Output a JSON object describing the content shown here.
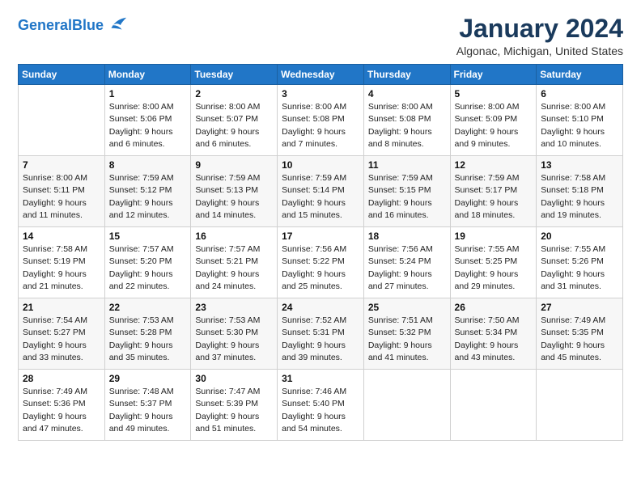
{
  "logo": {
    "line1": "General",
    "line2": "Blue"
  },
  "title": "January 2024",
  "subtitle": "Algonac, Michigan, United States",
  "days_of_week": [
    "Sunday",
    "Monday",
    "Tuesday",
    "Wednesday",
    "Thursday",
    "Friday",
    "Saturday"
  ],
  "weeks": [
    [
      {
        "day": "",
        "info": ""
      },
      {
        "day": "1",
        "info": "Sunrise: 8:00 AM\nSunset: 5:06 PM\nDaylight: 9 hours\nand 6 minutes."
      },
      {
        "day": "2",
        "info": "Sunrise: 8:00 AM\nSunset: 5:07 PM\nDaylight: 9 hours\nand 6 minutes."
      },
      {
        "day": "3",
        "info": "Sunrise: 8:00 AM\nSunset: 5:08 PM\nDaylight: 9 hours\nand 7 minutes."
      },
      {
        "day": "4",
        "info": "Sunrise: 8:00 AM\nSunset: 5:08 PM\nDaylight: 9 hours\nand 8 minutes."
      },
      {
        "day": "5",
        "info": "Sunrise: 8:00 AM\nSunset: 5:09 PM\nDaylight: 9 hours\nand 9 minutes."
      },
      {
        "day": "6",
        "info": "Sunrise: 8:00 AM\nSunset: 5:10 PM\nDaylight: 9 hours\nand 10 minutes."
      }
    ],
    [
      {
        "day": "7",
        "info": "Sunrise: 8:00 AM\nSunset: 5:11 PM\nDaylight: 9 hours\nand 11 minutes."
      },
      {
        "day": "8",
        "info": "Sunrise: 7:59 AM\nSunset: 5:12 PM\nDaylight: 9 hours\nand 12 minutes."
      },
      {
        "day": "9",
        "info": "Sunrise: 7:59 AM\nSunset: 5:13 PM\nDaylight: 9 hours\nand 14 minutes."
      },
      {
        "day": "10",
        "info": "Sunrise: 7:59 AM\nSunset: 5:14 PM\nDaylight: 9 hours\nand 15 minutes."
      },
      {
        "day": "11",
        "info": "Sunrise: 7:59 AM\nSunset: 5:15 PM\nDaylight: 9 hours\nand 16 minutes."
      },
      {
        "day": "12",
        "info": "Sunrise: 7:59 AM\nSunset: 5:17 PM\nDaylight: 9 hours\nand 18 minutes."
      },
      {
        "day": "13",
        "info": "Sunrise: 7:58 AM\nSunset: 5:18 PM\nDaylight: 9 hours\nand 19 minutes."
      }
    ],
    [
      {
        "day": "14",
        "info": "Sunrise: 7:58 AM\nSunset: 5:19 PM\nDaylight: 9 hours\nand 21 minutes."
      },
      {
        "day": "15",
        "info": "Sunrise: 7:57 AM\nSunset: 5:20 PM\nDaylight: 9 hours\nand 22 minutes."
      },
      {
        "day": "16",
        "info": "Sunrise: 7:57 AM\nSunset: 5:21 PM\nDaylight: 9 hours\nand 24 minutes."
      },
      {
        "day": "17",
        "info": "Sunrise: 7:56 AM\nSunset: 5:22 PM\nDaylight: 9 hours\nand 25 minutes."
      },
      {
        "day": "18",
        "info": "Sunrise: 7:56 AM\nSunset: 5:24 PM\nDaylight: 9 hours\nand 27 minutes."
      },
      {
        "day": "19",
        "info": "Sunrise: 7:55 AM\nSunset: 5:25 PM\nDaylight: 9 hours\nand 29 minutes."
      },
      {
        "day": "20",
        "info": "Sunrise: 7:55 AM\nSunset: 5:26 PM\nDaylight: 9 hours\nand 31 minutes."
      }
    ],
    [
      {
        "day": "21",
        "info": "Sunrise: 7:54 AM\nSunset: 5:27 PM\nDaylight: 9 hours\nand 33 minutes."
      },
      {
        "day": "22",
        "info": "Sunrise: 7:53 AM\nSunset: 5:28 PM\nDaylight: 9 hours\nand 35 minutes."
      },
      {
        "day": "23",
        "info": "Sunrise: 7:53 AM\nSunset: 5:30 PM\nDaylight: 9 hours\nand 37 minutes."
      },
      {
        "day": "24",
        "info": "Sunrise: 7:52 AM\nSunset: 5:31 PM\nDaylight: 9 hours\nand 39 minutes."
      },
      {
        "day": "25",
        "info": "Sunrise: 7:51 AM\nSunset: 5:32 PM\nDaylight: 9 hours\nand 41 minutes."
      },
      {
        "day": "26",
        "info": "Sunrise: 7:50 AM\nSunset: 5:34 PM\nDaylight: 9 hours\nand 43 minutes."
      },
      {
        "day": "27",
        "info": "Sunrise: 7:49 AM\nSunset: 5:35 PM\nDaylight: 9 hours\nand 45 minutes."
      }
    ],
    [
      {
        "day": "28",
        "info": "Sunrise: 7:49 AM\nSunset: 5:36 PM\nDaylight: 9 hours\nand 47 minutes."
      },
      {
        "day": "29",
        "info": "Sunrise: 7:48 AM\nSunset: 5:37 PM\nDaylight: 9 hours\nand 49 minutes."
      },
      {
        "day": "30",
        "info": "Sunrise: 7:47 AM\nSunset: 5:39 PM\nDaylight: 9 hours\nand 51 minutes."
      },
      {
        "day": "31",
        "info": "Sunrise: 7:46 AM\nSunset: 5:40 PM\nDaylight: 9 hours\nand 54 minutes."
      },
      {
        "day": "",
        "info": ""
      },
      {
        "day": "",
        "info": ""
      },
      {
        "day": "",
        "info": ""
      }
    ]
  ]
}
